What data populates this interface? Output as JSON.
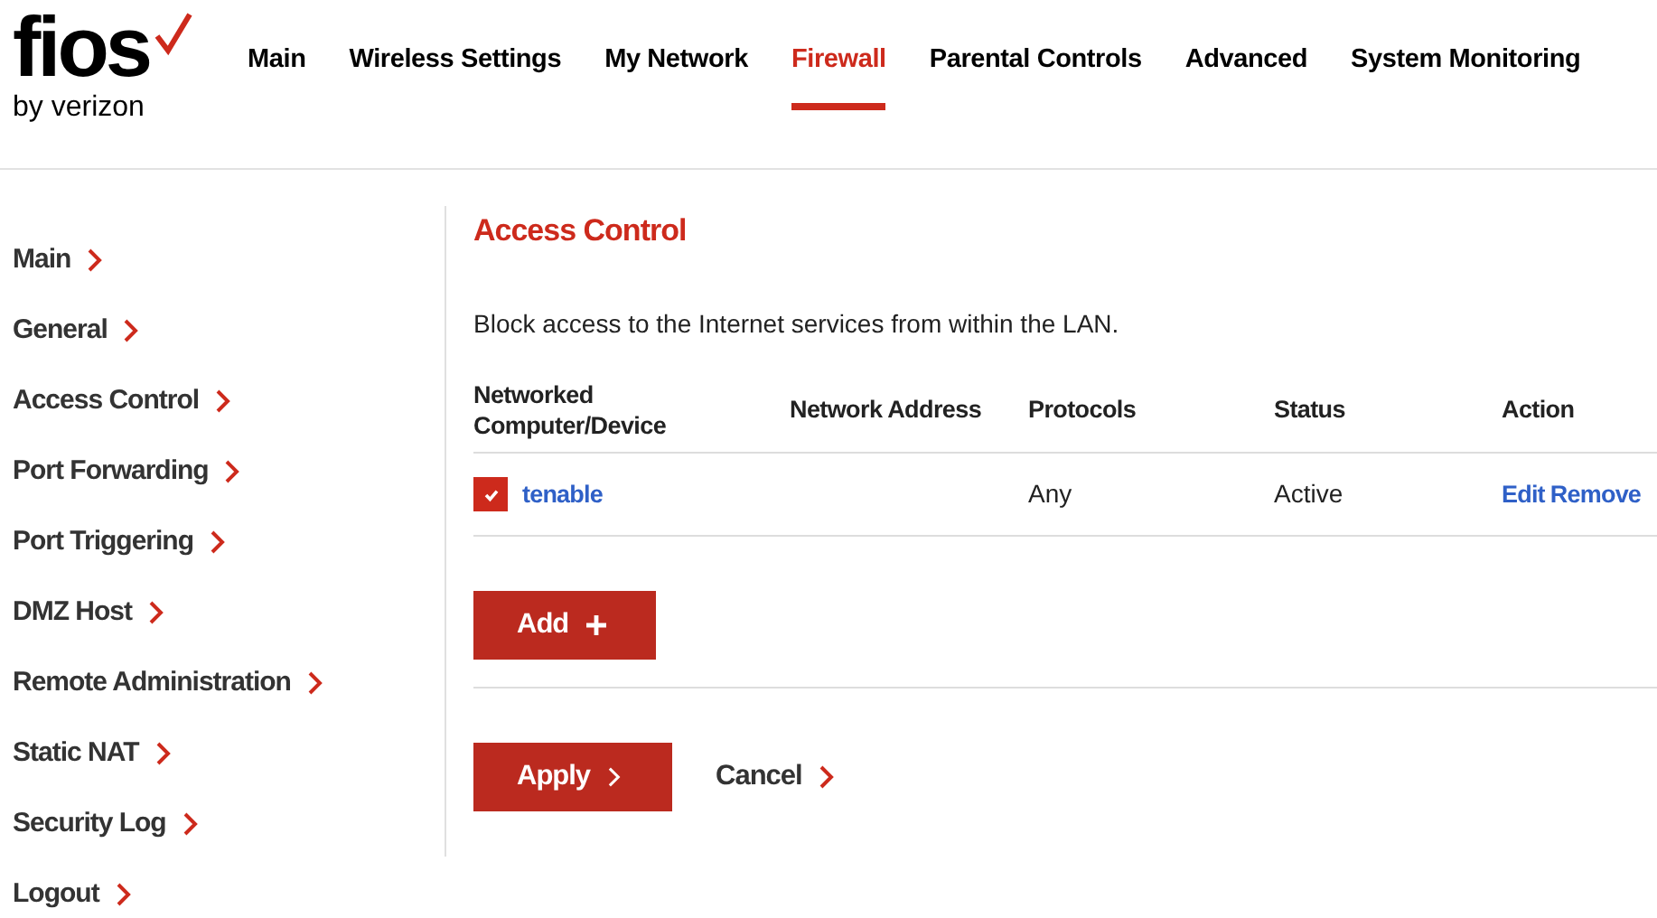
{
  "logo": {
    "wordmark": "fios",
    "tagline": "by verizon"
  },
  "nav": [
    {
      "label": "Main",
      "selected": false
    },
    {
      "label": "Wireless Settings",
      "selected": false
    },
    {
      "label": "My Network",
      "selected": false
    },
    {
      "label": "Firewall",
      "selected": true
    },
    {
      "label": "Parental Controls",
      "selected": false
    },
    {
      "label": "Advanced",
      "selected": false
    },
    {
      "label": "System Monitoring",
      "selected": false
    }
  ],
  "sidebar": {
    "items": [
      "Main",
      "General",
      "Access Control",
      "Port Forwarding",
      "Port Triggering",
      "DMZ Host",
      "Remote Administration",
      "Static NAT",
      "Security Log",
      "Logout"
    ]
  },
  "content": {
    "title": "Access Control",
    "description": "Block access to the Internet services from within the LAN.",
    "table": {
      "columns": [
        "Networked Computer/Device",
        "Network Address",
        "Protocols",
        "Status",
        "Action"
      ],
      "rows": [
        {
          "checked": true,
          "device": "tenable",
          "protocols": "Any",
          "status": "Active",
          "actions": [
            "Edit",
            "Remove"
          ]
        }
      ]
    },
    "add_button": "Add",
    "apply_button": "Apply",
    "cancel_button": "Cancel"
  }
}
